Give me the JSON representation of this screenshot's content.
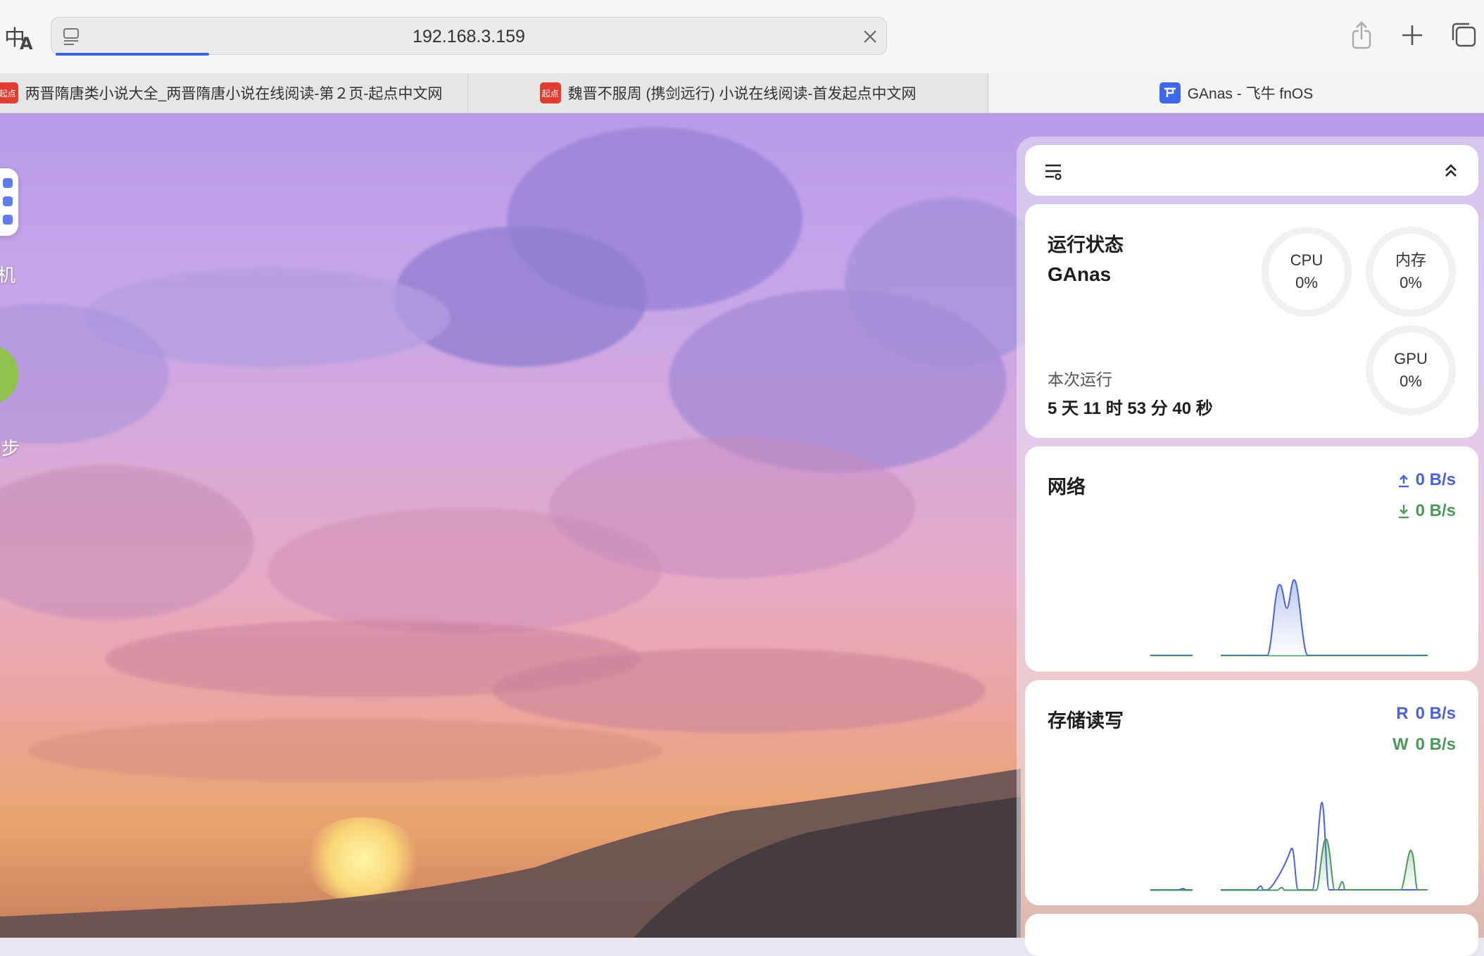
{
  "toolbar": {
    "url": "192.168.3.159",
    "translate_icon": "translate-icon",
    "reader_icon": "reader-icon",
    "clear_icon": "close-icon",
    "share_icon": "share-icon",
    "new_tab_icon": "plus-icon",
    "tab_overview_icon": "tabs-icon",
    "progress_color": "#3b62e0"
  },
  "tabs": [
    {
      "title": "两晋隋唐类小说大全_两晋隋唐小说在线阅读-第２页-起点中文网",
      "favicon": "起点"
    },
    {
      "title": "魏晋不服周 (携剑远行) 小说在线阅读-首发起点中文网",
      "favicon": "起点"
    },
    {
      "title": "GAnas - 飞牛 fnOS",
      "favicon": "fn-logo"
    }
  ],
  "desktop": {
    "icon_labels": [
      "机",
      "同步"
    ]
  },
  "status": {
    "title": "运行状态",
    "hostname": "GAnas",
    "uptime_label": "本次运行",
    "uptime_value": "5 天 11 时 53 分 40 秒",
    "gauges": [
      {
        "label": "CPU",
        "value": "0%",
        "level": 0
      },
      {
        "label": "内存",
        "value": "0%",
        "level": 0
      },
      {
        "label": "GPU",
        "value": "0%",
        "level": 0
      }
    ]
  },
  "network": {
    "title": "网络",
    "upload": "0 B/s",
    "download": "0 B/s",
    "upload_color": "#4a63e0",
    "download_color": "#4a9a5c"
  },
  "storage": {
    "title": "存储读写",
    "read_prefix": "R",
    "read": "0 B/s",
    "write_prefix": "W",
    "write": "0 B/s",
    "read_color": "#4a63e0",
    "write_color": "#4a9a5c"
  }
}
